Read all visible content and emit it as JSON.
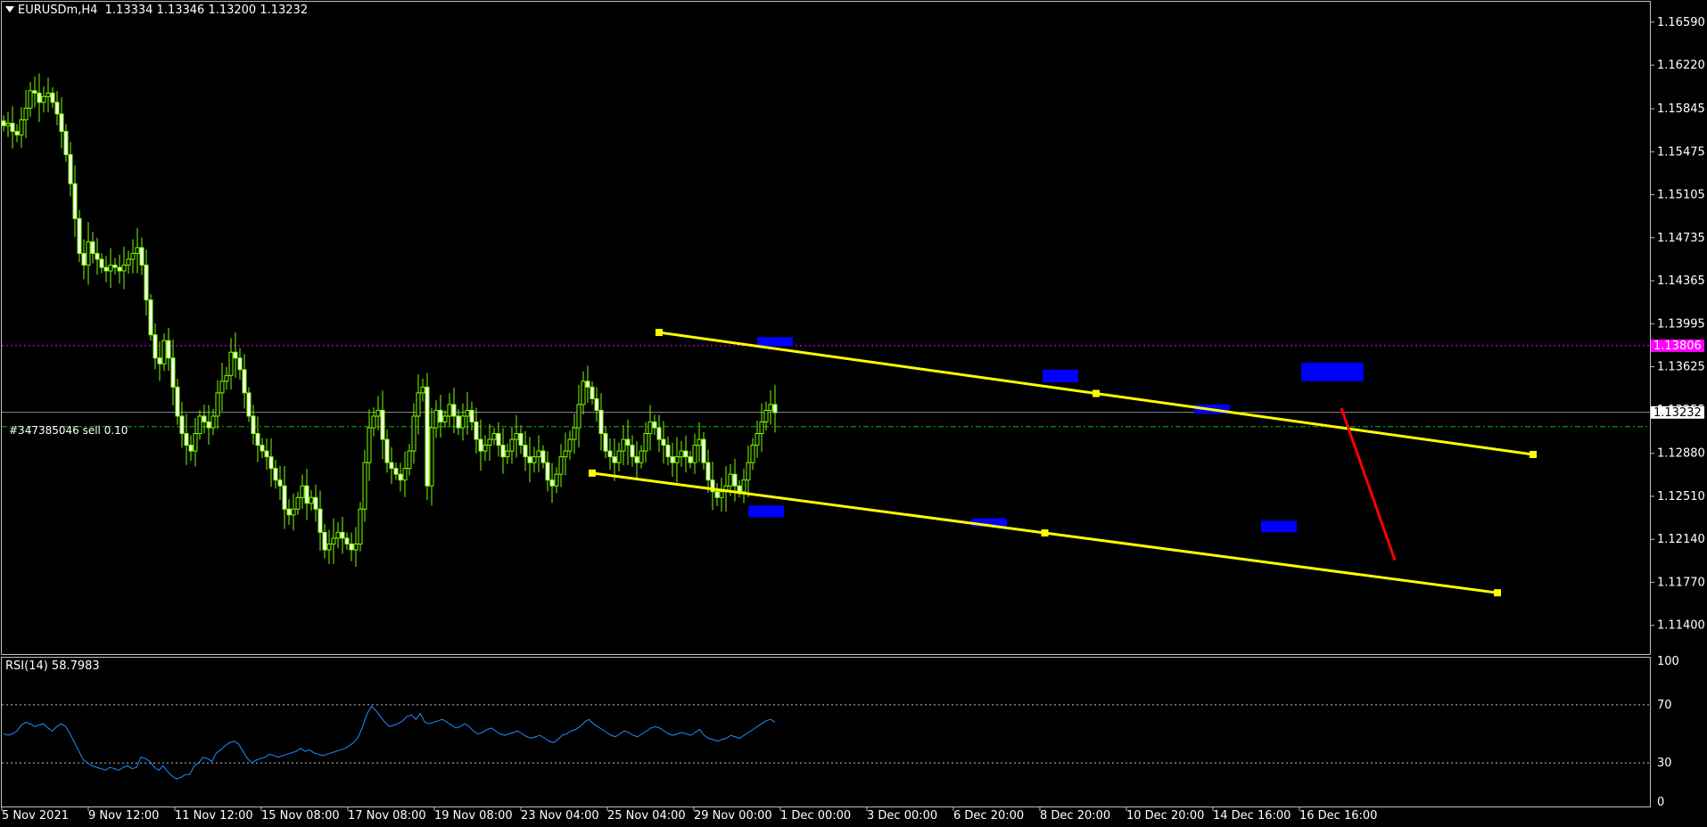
{
  "header": {
    "symbol": "EURUSDm,H4",
    "ohlc": "1.13334 1.13346 1.13200 1.13232"
  },
  "rsi_header": {
    "label": "RSI(14) 58.7983"
  },
  "order_label": "#347385046 sell 0.10",
  "colors": {
    "background": "#000000",
    "candle": "#7CFC00",
    "candle_body_up": "#000000",
    "candle_body_down": "#ffffff",
    "trend_lines": "#ffff00",
    "zones": "#0000ff",
    "arrow": "#ff0000",
    "rsi_line": "#1e90ff",
    "ask_line": "#ff00ff",
    "order_line": "#00c000",
    "grid": "#ffffff"
  },
  "chart_data": {
    "type": "candlestick",
    "symbol": "EURUSDm",
    "timeframe": "H4",
    "price_axis": {
      "ticks": [
        "1.16590",
        "1.16220",
        "1.15845",
        "1.15475",
        "1.15105",
        "1.14735",
        "1.14365",
        "1.13995",
        "1.13625",
        "1.13255",
        "1.12880",
        "1.12510",
        "1.12140",
        "1.11770",
        "1.11400"
      ],
      "range": [
        1.1116,
        1.1675
      ]
    },
    "time_axis": {
      "ticks": [
        "5 Nov 2021",
        "9 Nov 12:00",
        "11 Nov 12:00",
        "15 Nov 08:00",
        "17 Nov 08:00",
        "19 Nov 08:00",
        "23 Nov 04:00",
        "25 Nov 04:00",
        "29 Nov 00:00",
        "1 Dec 00:00",
        "3 Dec 00:00",
        "6 Dec 20:00",
        "8 Dec 20:00",
        "10 Dec 20:00",
        "14 Dec 16:00",
        "16 Dec 16:00"
      ]
    },
    "current_price": {
      "label": "1.13232",
      "value": 1.13232
    },
    "ask_price": {
      "label": "1.13806",
      "value": 1.13806
    },
    "order_price": 1.1311,
    "closes": [
      1.157,
      1.1572,
      1.1565,
      1.1562,
      1.1575,
      1.1585,
      1.16,
      1.1598,
      1.159,
      1.1595,
      1.1598,
      1.159,
      1.158,
      1.1565,
      1.1545,
      1.152,
      1.149,
      1.146,
      1.145,
      1.147,
      1.146,
      1.1455,
      1.1448,
      1.1445,
      1.145,
      1.1448,
      1.1445,
      1.145,
      1.1455,
      1.146,
      1.1465,
      1.145,
      1.142,
      1.139,
      1.137,
      1.1365,
      1.1385,
      1.137,
      1.1345,
      1.132,
      1.1305,
      1.1295,
      1.129,
      1.1305,
      1.132,
      1.1315,
      1.131,
      1.132,
      1.134,
      1.135,
      1.1355,
      1.1375,
      1.137,
      1.136,
      1.134,
      1.132,
      1.1305,
      1.1295,
      1.129,
      1.1285,
      1.1275,
      1.1265,
      1.126,
      1.124,
      1.1235,
      1.124,
      1.125,
      1.126,
      1.1245,
      1.125,
      1.124,
      1.122,
      1.1205,
      1.121,
      1.1215,
      1.122,
      1.1215,
      1.121,
      1.1205,
      1.121,
      1.124,
      1.128,
      1.131,
      1.132,
      1.1325,
      1.13,
      1.128,
      1.1275,
      1.127,
      1.1265,
      1.1275,
      1.129,
      1.132,
      1.134,
      1.1345,
      1.126,
      1.131,
      1.1325,
      1.1315,
      1.132,
      1.133,
      1.132,
      1.131,
      1.132,
      1.1325,
      1.1315,
      1.13,
      1.129,
      1.1295,
      1.13,
      1.1305,
      1.1295,
      1.1285,
      1.129,
      1.13,
      1.1305,
      1.1295,
      1.1285,
      1.128,
      1.1285,
      1.129,
      1.128,
      1.1265,
      1.126,
      1.127,
      1.1285,
      1.129,
      1.13,
      1.131,
      1.133,
      1.135,
      1.1345,
      1.1335,
      1.1325,
      1.1305,
      1.129,
      1.1285,
      1.128,
      1.129,
      1.13,
      1.1295,
      1.1285,
      1.128,
      1.129,
      1.1305,
      1.1315,
      1.131,
      1.13,
      1.1295,
      1.1285,
      1.128,
      1.1285,
      1.129,
      1.1285,
      1.128,
      1.1295,
      1.13,
      1.128,
      1.1265,
      1.1255,
      1.125,
      1.1255,
      1.126,
      1.127,
      1.126,
      1.1255,
      1.1265,
      1.128,
      1.1295,
      1.1305,
      1.1315,
      1.1325,
      1.133,
      1.1323
    ],
    "trend_lines": [
      {
        "name": "upper-channel-line",
        "from": {
          "index": 147,
          "price": 1.1392
        },
        "to": {
          "index": 343,
          "price": 1.1287
        }
      },
      {
        "name": "lower-channel-line",
        "from": {
          "index": 132,
          "price": 1.1271
        },
        "to": {
          "index": 335,
          "price": 1.1168
        }
      }
    ],
    "zones": [
      {
        "name": "zone-high-1",
        "x1_index": 169,
        "x2_index": 177,
        "top": 1.1388,
        "bottom": 1.138
      },
      {
        "name": "zone-low-1",
        "x1_index": 167,
        "x2_index": 175,
        "top": 1.1243,
        "bottom": 1.1233
      },
      {
        "name": "zone-low-2",
        "x1_index": 217,
        "x2_index": 225,
        "top": 1.1232,
        "bottom": 1.1225
      },
      {
        "name": "zone-high-2",
        "x1_index": 233,
        "x2_index": 241,
        "top": 1.136,
        "bottom": 1.1349
      },
      {
        "name": "zone-high-3",
        "x1_index": 267,
        "x2_index": 275,
        "top": 1.133,
        "bottom": 1.1322
      },
      {
        "name": "zone-low-3",
        "x1_index": 282,
        "x2_index": 290,
        "top": 1.123,
        "bottom": 1.122
      },
      {
        "name": "zone-high-4",
        "x1_index": 291,
        "x2_index": 305,
        "top": 1.1366,
        "bottom": 1.135
      }
    ],
    "arrow": {
      "from": {
        "index": 300,
        "price": 1.1327
      },
      "to": {
        "index": 312,
        "price": 1.1196
      }
    },
    "rsi": {
      "period": 14,
      "value": 58.7983,
      "levels": [
        70,
        30
      ],
      "axis_ticks": [
        "100",
        "70",
        "30",
        "0"
      ],
      "values": [
        50,
        49,
        50,
        52,
        56,
        58,
        57,
        55,
        56,
        57,
        54,
        52,
        55,
        57,
        55,
        50,
        44,
        38,
        32,
        30,
        28,
        27,
        26,
        25,
        27,
        26,
        25,
        27,
        28,
        26,
        27,
        34,
        33,
        31,
        27,
        25,
        28,
        24,
        21,
        19,
        20,
        22,
        22,
        28,
        30,
        34,
        33,
        31,
        37,
        39,
        42,
        44,
        45,
        43,
        38,
        33,
        30,
        32,
        33,
        34,
        36,
        35,
        34,
        35,
        36,
        37,
        38,
        40,
        38,
        39,
        37,
        36,
        35,
        36,
        37,
        38,
        39,
        40,
        42,
        44,
        48,
        55,
        64,
        69,
        66,
        62,
        58,
        55,
        56,
        57,
        59,
        62,
        63,
        60,
        64,
        58,
        57,
        58,
        59,
        60,
        58,
        56,
        54,
        55,
        57,
        55,
        52,
        50,
        51,
        53,
        54,
        52,
        50,
        49,
        50,
        51,
        52,
        50,
        48,
        47,
        48,
        49,
        47,
        45,
        44,
        46,
        49,
        50,
        52,
        53,
        55,
        58,
        60,
        57,
        55,
        53,
        51,
        49,
        48,
        50,
        52,
        51,
        49,
        48,
        50,
        52,
        54,
        55,
        54,
        52,
        50,
        49,
        50,
        51,
        50,
        49,
        51,
        53,
        49,
        47,
        46,
        45,
        46,
        47,
        49,
        48,
        47,
        49,
        51,
        53,
        55,
        57,
        59,
        60,
        58
      ]
    }
  }
}
